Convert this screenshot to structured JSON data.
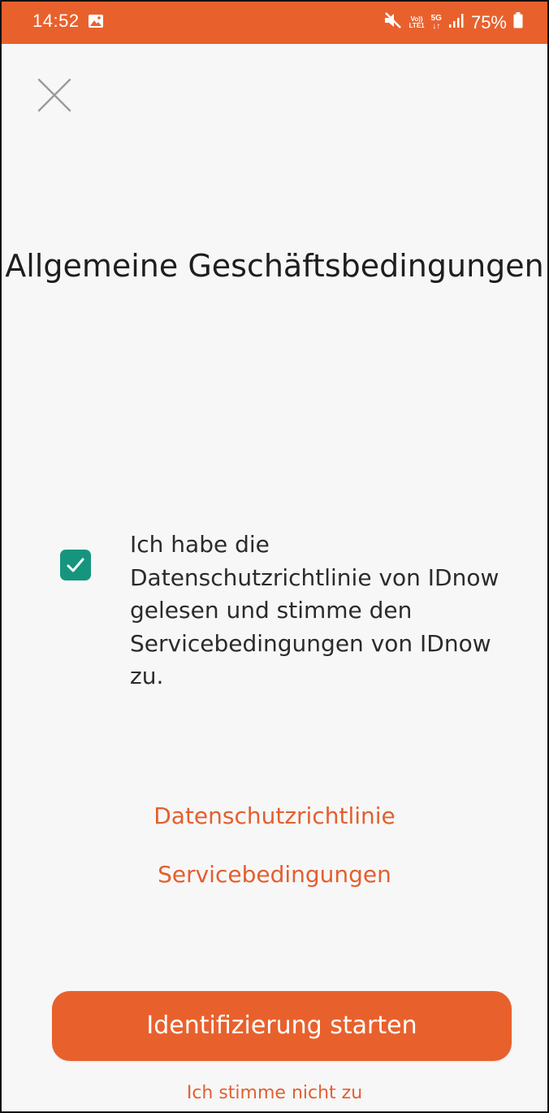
{
  "status_bar": {
    "time": "14:52",
    "volte_label_top": "Vo))",
    "volte_label_bottom": "LTE1",
    "network_label_top": "5G",
    "network_label_bottom": "↓↑",
    "battery_text": "75%",
    "background_color": "#e8612d",
    "icons": [
      "gallery-icon",
      "mute-icon",
      "volte-icon",
      "5g-icon",
      "signal-icon",
      "battery-icon"
    ]
  },
  "header": {
    "close_icon": "close-icon"
  },
  "page": {
    "title": "Allgemeine Geschäftsbedingungen"
  },
  "consent": {
    "checked": true,
    "checkbox_color": "#16957e",
    "text": "Ich habe die Datenschutzrichtlinie von IDnow gelesen und stimme den Servicebedingungen von IDnow zu."
  },
  "links": {
    "privacy_policy": "Datenschutzrichtlinie",
    "terms_of_service": "Servicebedingungen",
    "color": "#e35f2f"
  },
  "actions": {
    "start_button": "Identifizierung starten",
    "decline_link": "Ich stimme nicht zu",
    "accent_color": "#e8612d"
  }
}
